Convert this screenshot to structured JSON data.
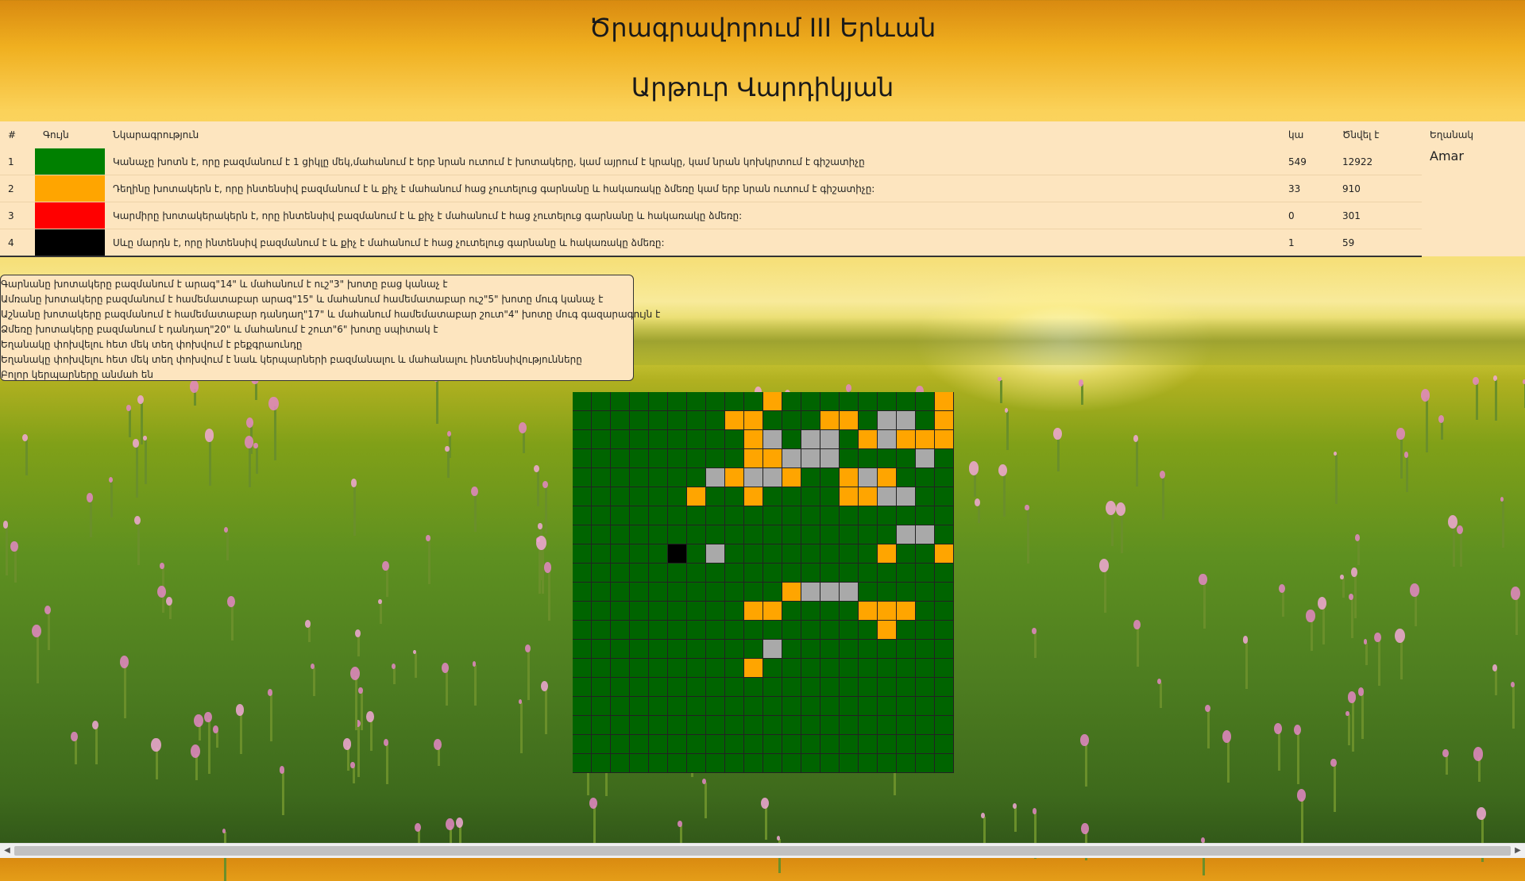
{
  "header": {
    "title": "Ծրագրավորում III Երևան",
    "subtitle": "Արթուր Վարդիկյան"
  },
  "legend": {
    "columns": [
      "#",
      "Գույն",
      "Նկարագրություն",
      "կա",
      "Ծնվել է",
      "Եղանակ"
    ],
    "weather": "Amar",
    "rows": [
      {
        "num": "1",
        "color": "#008000",
        "desc": "Կանաչը խոտն է, որը բազմանում է 1 ցիկլը մեկ,մահանում է երբ նրան ուտում է խոտակերը, կամ այրում է կրակը, կամ նրան կոխկրտում է գիշատիչը",
        "exists": "549",
        "born": "12922"
      },
      {
        "num": "2",
        "color": "#FFA500",
        "desc": "Դեղինը խոտակերն է, որը ինտենսիվ բազմանում է և քիչ է մահանում հաց չուտելուց գարնանը և հակառակը ձմեռը կամ երբ նրան ուտում է գիշատիչը:",
        "exists": "33",
        "born": "910"
      },
      {
        "num": "3",
        "color": "#FF0000",
        "desc": "Կարմիրը խոտակերակերն է, որը ինտենսիվ բազմանում է և քիչ է մահանում է հաց չուտելուց գարնանը և հակառակը ձմեռը:",
        "exists": "0",
        "born": "301"
      },
      {
        "num": "4",
        "color": "#000000",
        "desc": "Սևը մարդն է, որը ինտենսիվ բազմանում է և քիչ է մահանում է հաց չուտելուց գարնանը և հակառակը ձմեռը:",
        "exists": "1",
        "born": "59"
      }
    ]
  },
  "notes": [
    "Գարնանը խոտակերը բազմանում է արագ\"14\" և մահանում է ուշ\"3\" խոտը բաց կանաչ է",
    "Ամռանը խոտակերը բազմանում է համեմատաբար արագ\"15\" և մահանում համեմատաբար ուշ\"5\" խոտը մուգ կանաչ է",
    "Աշնանը խոտակերը բազմանում է համեմատաբար դանդաղ\"17\" և մահանում համեմատաբար շուտ\"4\" խոտը մուգ գազարագույն է",
    "Ձմեռը խոտակերը բազմանում է դանդաղ\"20\" և մահանում է շուտ\"6\" խոտը սպիտակ է",
    "Եղանակը փոխվելու հետ մեկ տեղ փոխվում է բեքգրաունդը",
    "Եղանակը փոխվելու հետ մեկ տեղ փոխվում է նաև կերպարների բազմանալու և մահանալու ինտենսիվությունները",
    "Բոլոր կերպարները անմահ են"
  ],
  "grid": {
    "size": 20,
    "colors": {
      "G": "#006400",
      "Y": "#FFA500",
      "S": "#A9A9A9",
      "B": "#000000"
    },
    "rows": [
      "GGGGGGGGGGYGGGGGGGGY",
      "GGGGGGGGYYGGGYYGSSGY",
      "GGGGGGGGGYSGSSGYSYYY",
      "GGGGGGGGGYYSSSGGGGSG",
      "GGGGGGGSYSSYGGYSYGGG",
      "GGGGGGYGGYGGGGYYSSGG",
      "GGGGGGGGGGGGGGGGGGGG",
      "GGGGGGGGGGGGGGGGGSSG",
      "GGGGGBGSGGGGGGGGYGGY",
      "GGGGGGGGGGGGGGGGGGGG",
      "GGGGGGGGGGGYSSSGGGGG",
      "GGGGGGGGGYYGGGGYYYGG",
      "GGGGGGGGGGGGGGGGYGGG",
      "GGGGGGGGGGSGGGGGGGGG",
      "GGGGGGGGGYGGGGGGGGGG",
      "GGGGGGGGGGGGGGGGGGGG",
      "GGGGGGGGGGGGGGGGGGGG",
      "GGGGGGGGGGGGGGGGGGGG",
      "GGGGGGGGGGGGGGGGGGGG",
      "GGGGGGGGGGGGGGGGGGGG"
    ]
  },
  "scrollbar": {
    "left_arrow": "◀",
    "right_arrow": "▶"
  }
}
